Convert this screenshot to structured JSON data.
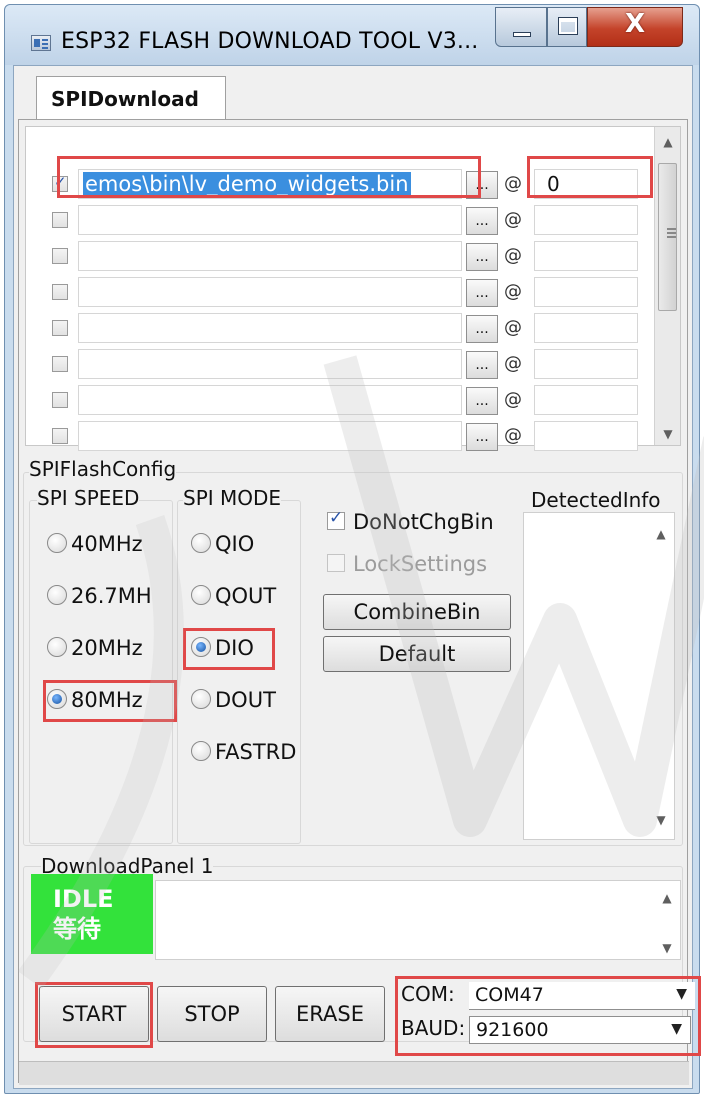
{
  "window": {
    "title": "ESP32 FLASH DOWNLOAD TOOL V3...",
    "close_glyph": "X"
  },
  "tabs": [
    {
      "label": "SPIDownload"
    }
  ],
  "file_list": {
    "rows": [
      {
        "checked": true,
        "path": "emos\\bin\\lv_demo_widgets.bin",
        "address": "0",
        "browse": "...",
        "at": "@"
      },
      {
        "checked": false,
        "path": "",
        "address": "",
        "browse": "...",
        "at": "@"
      },
      {
        "checked": false,
        "path": "",
        "address": "",
        "browse": "...",
        "at": "@"
      },
      {
        "checked": false,
        "path": "",
        "address": "",
        "browse": "...",
        "at": "@"
      },
      {
        "checked": false,
        "path": "",
        "address": "",
        "browse": "...",
        "at": "@"
      },
      {
        "checked": false,
        "path": "",
        "address": "",
        "browse": "...",
        "at": "@"
      },
      {
        "checked": false,
        "path": "",
        "address": "",
        "browse": "...",
        "at": "@"
      },
      {
        "checked": false,
        "path": "",
        "address": "",
        "browse": "...",
        "at": "@"
      }
    ]
  },
  "spi_flash_config": {
    "label": "SPIFlashConfig",
    "speed": {
      "label": "SPI SPEED",
      "options": [
        "40MHz",
        "26.7MH",
        "20MHz",
        "80MHz"
      ],
      "selected": "80MHz"
    },
    "mode": {
      "label": "SPI MODE",
      "options": [
        "QIO",
        "QOUT",
        "DIO",
        "DOUT",
        "FASTRD"
      ],
      "selected": "DIO"
    },
    "do_not_chg_bin": {
      "label": "DoNotChgBin",
      "checked": true
    },
    "lock_settings": {
      "label": "LockSettings",
      "checked": false,
      "disabled": true
    },
    "combine_bin_label": "CombineBin",
    "default_label": "Default",
    "detected_info_label": "DetectedInfo"
  },
  "download_panel": {
    "label": "DownloadPanel 1",
    "status_en": "IDLE",
    "status_cn": "等待",
    "status_color": "#33e23b",
    "start_label": "START",
    "stop_label": "STOP",
    "erase_label": "ERASE",
    "com_label": "COM:",
    "com_value": "COM47",
    "baud_label": "BAUD:",
    "baud_value": "921600"
  },
  "colors": {
    "highlight": "#e04848",
    "selection": "#3b8fdf",
    "watermark": "#bdbdbd"
  },
  "icons": {
    "app": "app-icon",
    "minimize": "minimize-icon",
    "maximize": "maximize-icon",
    "close": "close-icon",
    "scroll_up": "scroll-up-icon",
    "scroll_down": "scroll-down-icon",
    "dropdown": "chevron-down-icon"
  }
}
